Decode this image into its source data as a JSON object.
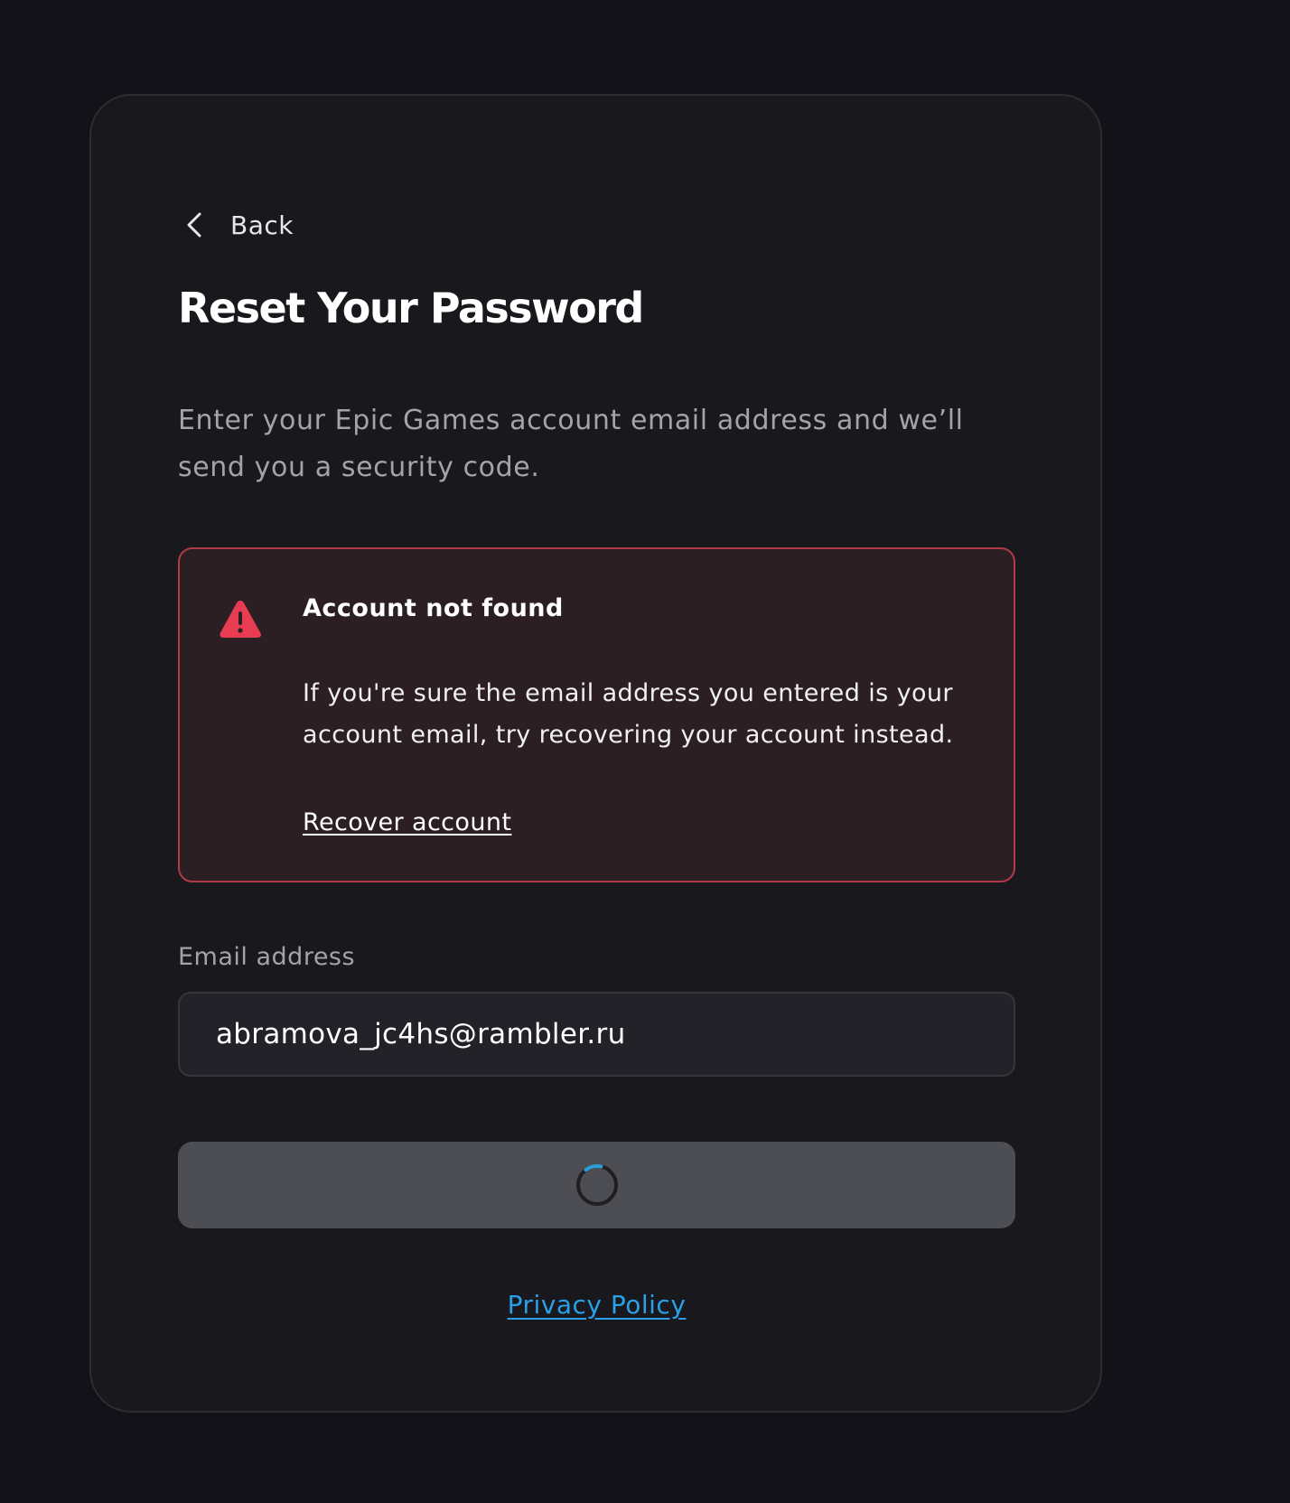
{
  "nav": {
    "back_label": "Back"
  },
  "header": {
    "title": "Reset Your Password",
    "subtitle": "Enter your Epic Games account email address and we’ll send you a security code."
  },
  "alert": {
    "icon": "warning-triangle-icon",
    "title": "Account not found",
    "body": "If you're sure the email address you entered is your account email, try recovering your account instead.",
    "link_label": "Recover account"
  },
  "form": {
    "email_label": "Email address",
    "email_value": "abramova_jc4hs@rambler.ru",
    "submit_state": "loading"
  },
  "footer": {
    "privacy_label": "Privacy Policy"
  },
  "colors": {
    "page_background": "#121218",
    "card_background": "#18181d",
    "alert_background": "#2b1f24",
    "alert_border": "#b03a48",
    "warning_icon": "#e83c52",
    "button_background": "#4d4d54",
    "link_accent": "#2aa0e8",
    "spinner_accent": "#2a9fd8"
  }
}
